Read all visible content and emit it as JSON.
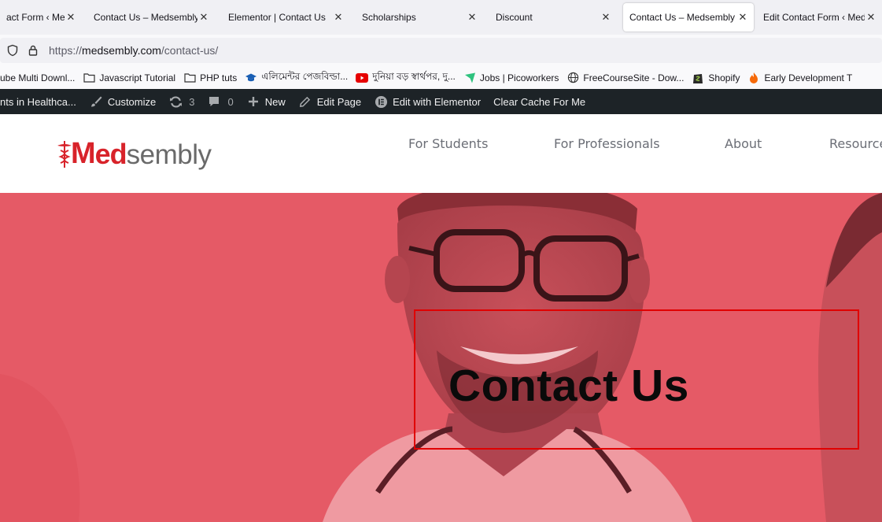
{
  "tabs": [
    {
      "label": "act Form ‹ Meds",
      "active": false
    },
    {
      "label": "Contact Us – Medsembly",
      "active": false
    },
    {
      "label": "Elementor | Contact Us",
      "active": false
    },
    {
      "label": "Scholarships",
      "active": false
    },
    {
      "label": "Discount",
      "active": false
    },
    {
      "label": "Contact Us – Medsembly",
      "active": true
    },
    {
      "label": "Edit Contact Form ‹ Meds",
      "active": false
    }
  ],
  "address": {
    "url_prefix": "https://",
    "url_domain": "medsembly.com",
    "url_path": "/contact-us/"
  },
  "bookmarks": [
    {
      "label": "ube Multi Downl...",
      "icon": "none"
    },
    {
      "label": "Javascript Tutorial",
      "icon": "folder-icon"
    },
    {
      "label": "PHP tuts",
      "icon": "folder-icon"
    },
    {
      "label": "এলিমেন্টর পেজবিল্ডা...",
      "icon": "graduation-cap-icon"
    },
    {
      "label": "দুনিয়া বড় স্বার্থপর, দু...",
      "icon": "youtube-icon"
    },
    {
      "label": "Jobs | Picoworkers",
      "icon": "arrow-icon"
    },
    {
      "label": "FreeCourseSite - Dow...",
      "icon": "globe-icon"
    },
    {
      "label": "Shopify",
      "icon": "shopify-icon"
    },
    {
      "label": "Early Development T",
      "icon": "flame-icon"
    }
  ],
  "adminbar": {
    "site_label": "nts in Healthca...",
    "customize": "Customize",
    "updates_count": "3",
    "comments_count": "0",
    "new": "New",
    "edit_page": "Edit Page",
    "edit_elementor": "Edit with Elementor",
    "clear_cache": "Clear Cache For Me"
  },
  "site": {
    "logo_m": "M",
    "logo_red": "ed",
    "logo_gray": "sembly",
    "nav": [
      "For Students",
      "For Professionals",
      "About",
      "Resources"
    ]
  },
  "hero": {
    "title": "Contact Us",
    "overlay_color": "#e55a66",
    "highlight_color": "#e00000"
  },
  "colors": {
    "brand_red": "#d8232a",
    "adminbar_bg": "#1d2327"
  }
}
